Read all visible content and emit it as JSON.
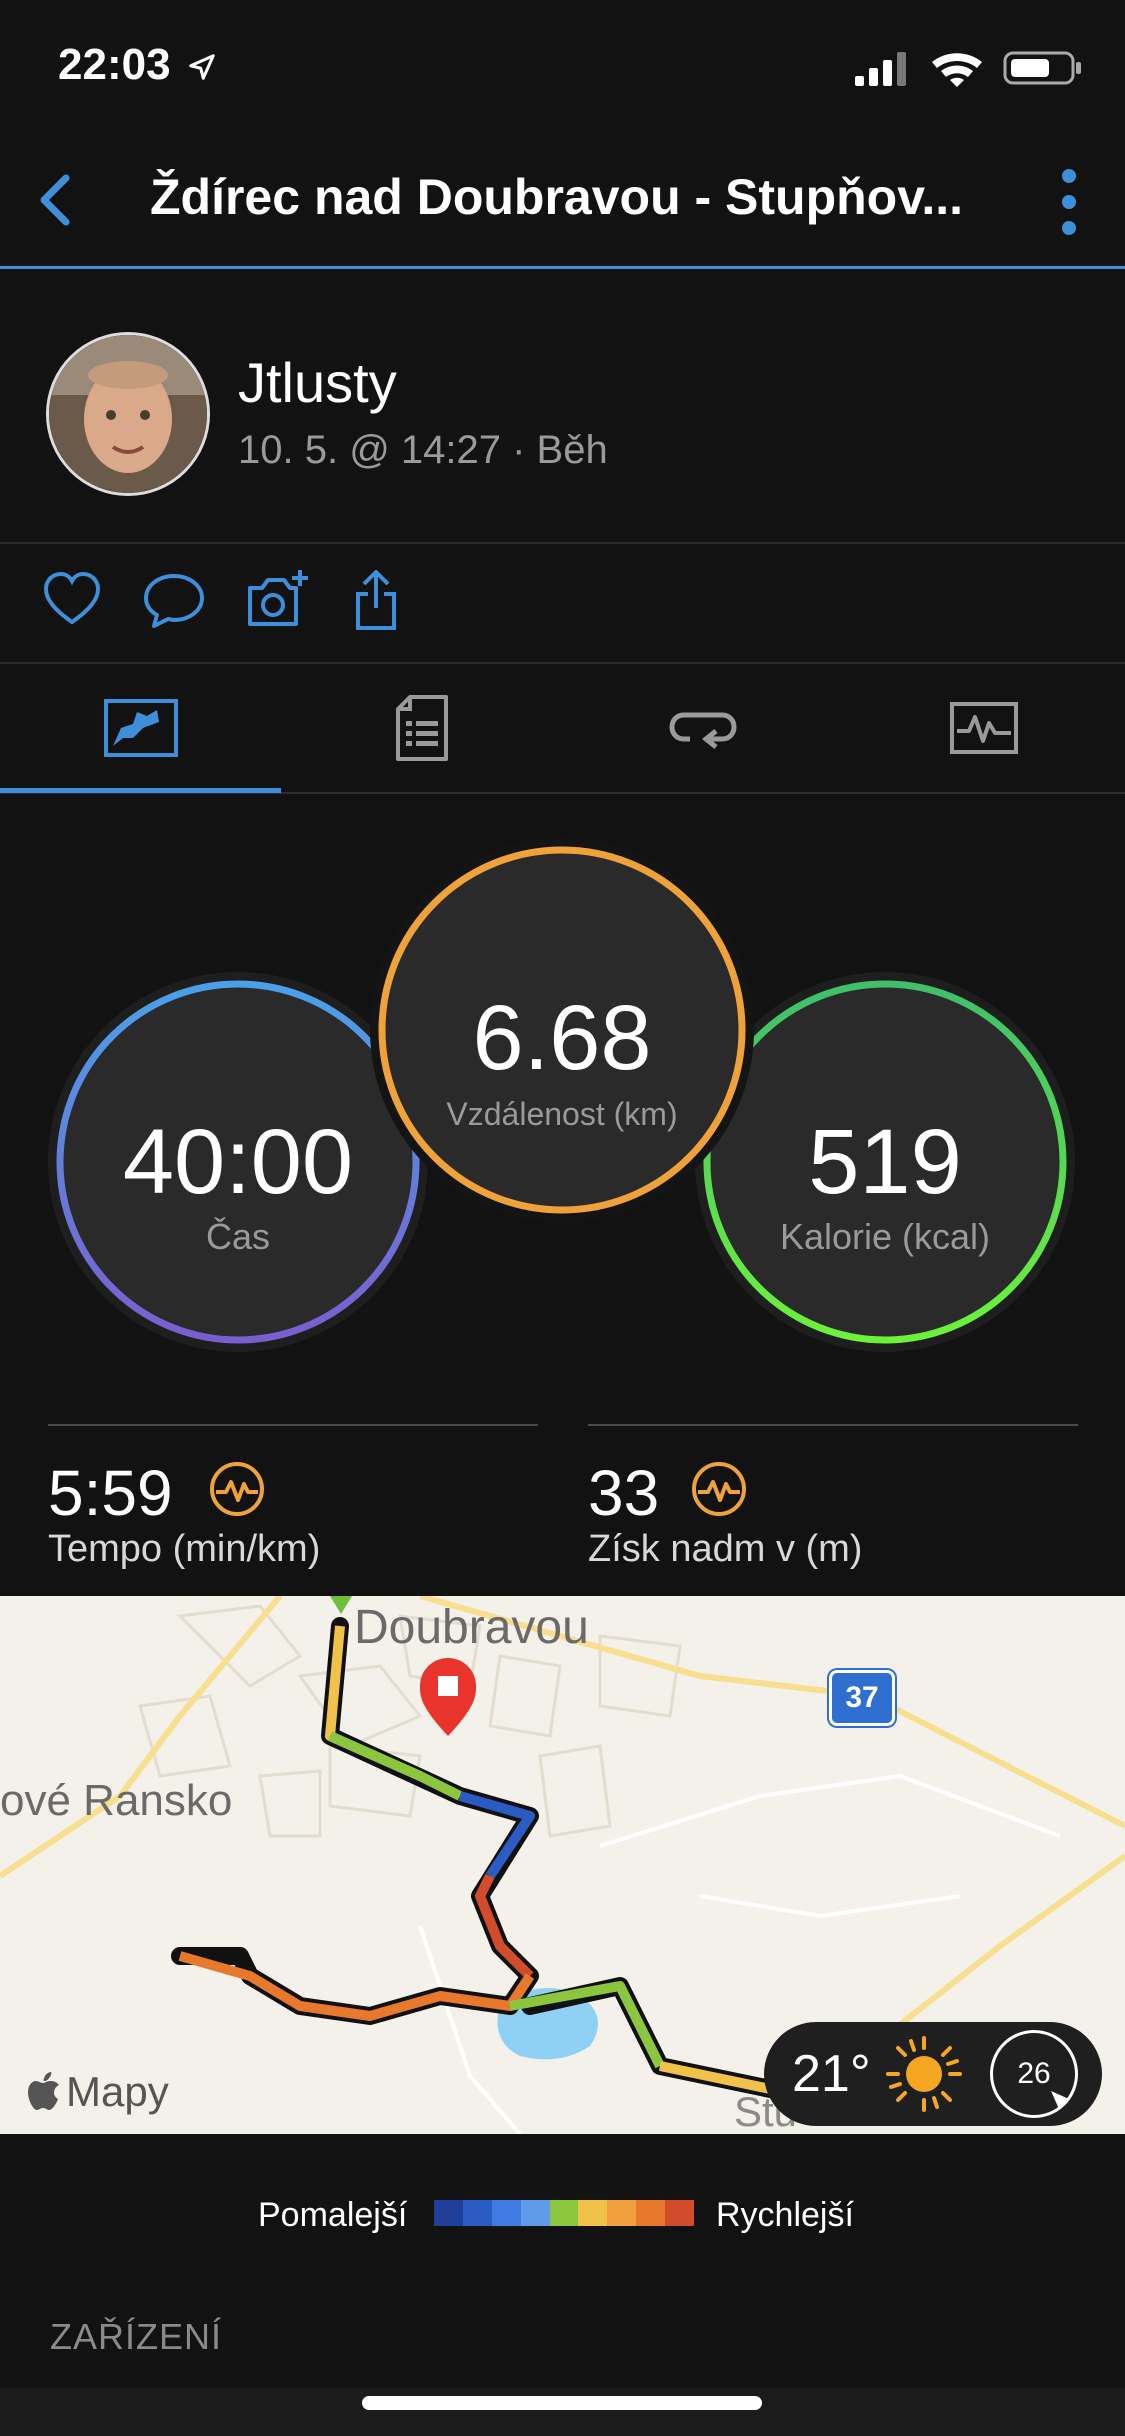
{
  "status": {
    "time": "22:03"
  },
  "nav": {
    "title": "Ždírec nad Doubravou - Stupňov..."
  },
  "user": {
    "name": "Jtlusty",
    "meta": "10. 5. @ 14:27 · Běh"
  },
  "stats": {
    "time": {
      "value": "40:00",
      "label": "Čas"
    },
    "distance": {
      "value": "6.68",
      "label": "Vzdálenost (km)"
    },
    "calories": {
      "value": "519",
      "label": "Kalorie (kcal)"
    }
  },
  "metrics": {
    "pace": {
      "value": "5:59",
      "label": "Tempo (min/km)"
    },
    "elevation": {
      "value": "33",
      "label": "Získ nadm v (m)"
    }
  },
  "map": {
    "place_top": "Doubravou",
    "place_left": "ové Ransko",
    "place_bottom": "Stu",
    "road_badge": "37",
    "brand": "Mapy",
    "weather": {
      "temperature": "21°",
      "wind": "26"
    }
  },
  "legend": {
    "slow": "Pomalejší",
    "fast": "Rychlejší",
    "colors": [
      "#1f3f9a",
      "#2a5cc4",
      "#3f7be0",
      "#5f9be8",
      "#8cc63f",
      "#f0c24a",
      "#f0a03c",
      "#e8782c",
      "#d24c2c"
    ]
  },
  "section": {
    "device_title": "ZAŘÍZENÍ"
  },
  "colors": {
    "accent": "#3d8fd9",
    "orange": "#f0a23a",
    "green": "#62d64a"
  }
}
